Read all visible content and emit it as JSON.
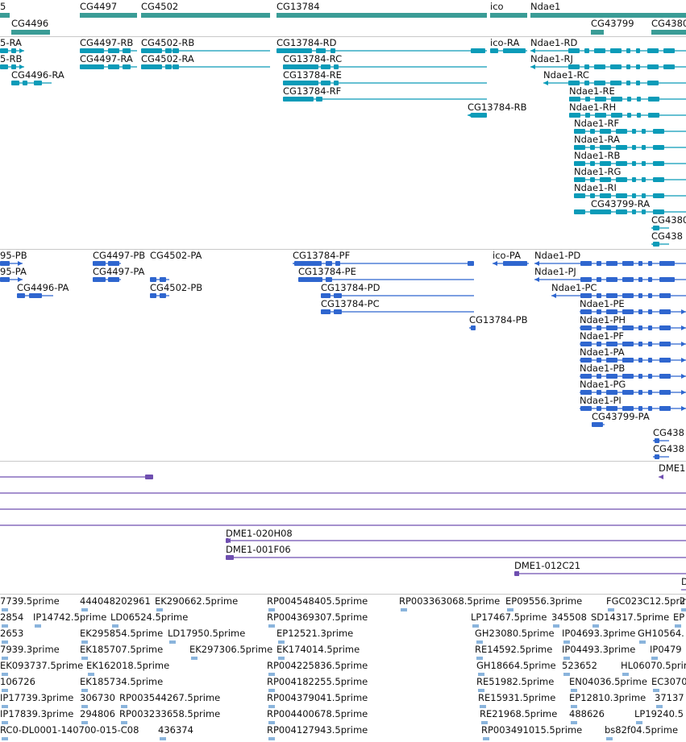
{
  "colors": {
    "gene": "#3a9c96",
    "transcript": "#0a9bb8",
    "protein": "#2f66cf",
    "clone": "#6f4fb0",
    "est": "#8ab4dc",
    "separator": "#c9c9c9"
  },
  "genes_track": {
    "labels": [
      "5",
      "CG4497",
      "CG4502",
      "CG13784",
      "ico",
      "Ndae1",
      "CG4496",
      "CG43799",
      "CG4380"
    ]
  },
  "transcripts_track": {
    "labels": [
      "5-RA",
      "5-RB",
      "CG4496-RA",
      "CG4497-RB",
      "CG4497-RA",
      "CG4502-RB",
      "CG4502-RA",
      "CG13784-RD",
      "CG13784-RC",
      "CG13784-RE",
      "CG13784-RF",
      "CG13784-RB",
      "ico-RA",
      "Ndae1-RD",
      "Ndae1-RJ",
      "Ndae1-RC",
      "Ndae1-RE",
      "Ndae1-RH",
      "Ndae1-RF",
      "Ndae1-RA",
      "Ndae1-RB",
      "Ndae1-RG",
      "Ndae1-RI",
      "CG43799-RA",
      "CG4380",
      "CG438"
    ]
  },
  "proteins_track": {
    "labels": [
      "95-PB",
      "95-PA",
      "CG4496-PA",
      "CG4497-PB",
      "CG4502-PA",
      "CG4497-PA",
      "CG4502-PB",
      "CG13784-PF",
      "CG13784-PE",
      "CG13784-PD",
      "CG13784-PC",
      "CG13784-PB",
      "ico-PA",
      "Ndae1-PD",
      "Ndae1-PJ",
      "Ndae1-PC",
      "Ndae1-PE",
      "Ndae1-PH",
      "Ndae1-PF",
      "Ndae1-PA",
      "Ndae1-PB",
      "Ndae1-PG",
      "Ndae1-PI",
      "CG43799-PA",
      "CG438",
      "CG438"
    ]
  },
  "clones_track": {
    "labels": [
      "DME1",
      "DME1-020H08",
      "DME1-001F06",
      "DME1-012C21",
      "D"
    ]
  },
  "est_track": {
    "labels": [
      "7739.5prime",
      "444048202961",
      "EK290662.5prime",
      "RP004548405.5prime",
      "RP003363068.5prime",
      "EP09556.3prime",
      "FGC023C12.5prime",
      "2",
      "2854",
      "IP14742.5prime",
      "LD06524.5prime",
      "RP004369307.5prime",
      "LP17467.5prime",
      "345508",
      "SD14317.5prime",
      "EP",
      "2653",
      "EK295854.5prime",
      "LD17950.5prime",
      "EP12521.3prime",
      "GH23080.5prime",
      "IP04693.3prime",
      "GH10564.",
      "7939.3prime",
      "EK185707.5prime",
      "EK297306.5prime",
      "EK174014.5prime",
      "RE14592.5prime",
      "IP04493.3prime",
      "IP0479",
      "EK093737.5prime",
      "EK162018.5prime",
      "RP004225836.5prime",
      "GH18664.5prime",
      "523652",
      "HL06070.5prime",
      "106726",
      "EK185734.5prime",
      "RP004182255.5prime",
      "RE51982.5prime",
      "EN04036.5prime",
      "EC3070",
      "IP17739.3prime",
      "306730",
      "RP003544267.5prime",
      "RP004379041.5prime",
      "RE15931.5prime",
      "EP12810.3prime",
      "37137",
      "IP17839.3prime",
      "294806",
      "RP003233658.5prime",
      "RP004400678.5prime",
      "RE21968.5prime",
      "488626",
      "LP19240.5",
      "RC0-DL0001-140700-015-C08",
      "436374",
      "RP004127943.5prime",
      "RP003491015.5prime",
      "bs82f04.5prime"
    ]
  }
}
